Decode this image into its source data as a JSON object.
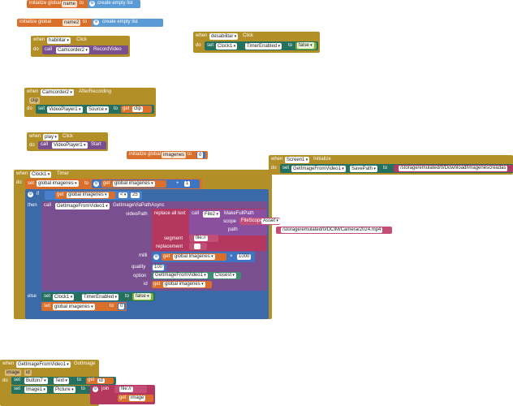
{
  "labels": {
    "init_global": "initialize global",
    "init_global_lc": "initialize global",
    "to": "to",
    "create_empty_list": "create empty list",
    "when": "when",
    "do": "do",
    "call": "call",
    "set": "set",
    "get": "get",
    "if": "if",
    "then": "then",
    "else": "else",
    "join": "join",
    "replace_all_text": "replace all text",
    "segment": "segment",
    "replacement": "replacement",
    "scope": "scope",
    "path": "path",
    "videoPath": "videoPath",
    "milli": "milli",
    "quality": "quality",
    "option": "option",
    "id": "id",
    "times": "×",
    "plus": "+",
    "lt": "<"
  },
  "blocks": {
    "init_name": {
      "var": "name",
      "value": "create empty list"
    },
    "init_name2": {
      "var": "name2",
      "value": "create empty list"
    },
    "habilitar": {
      "component": "habilitar",
      "event": "Click",
      "call_component": "Camcorder2",
      "method": "RecordVideo"
    },
    "desabilitar": {
      "component": "desabilitar",
      "event": "Click",
      "set_component": "Clock1",
      "property": "TimerEnabled",
      "value": "false"
    },
    "after_recording": {
      "component": "Camcorder2",
      "event": "AfterRecording",
      "param": "clip",
      "set_component": "VideoPlayer1",
      "property": "Source",
      "get_var": "clip"
    },
    "play": {
      "component": "play",
      "event": "Click",
      "call_component": "VideoPlayer1",
      "method": "Start"
    },
    "init_imagenes": {
      "var": "imagenes",
      "value": "0"
    },
    "screen_init": {
      "component": "Screen1",
      "event": "Initialize",
      "set_component": "GetImageFromVideo1",
      "property": "SavePath",
      "value": "/storage/emulated/0/Download/imagenescreadas"
    },
    "timer": {
      "component": "Clock1",
      "event": "Timer",
      "set_var": "global imagenes",
      "get_var": "global imagenes",
      "add_value": "1",
      "cond_var": "global imagenes",
      "cond_value": "25",
      "call_component": "GetImageFromVideo1",
      "method": "GetImageViaPathAsync",
      "file_component": "File2",
      "file_method": "MakeFullPath",
      "scope_value": "FileScope",
      "scope_option": "Asset",
      "path_value": "/storage/emulated/0/DCIM/Camera/2024.mp4",
      "segment_value": "file://",
      "replacement_value": "",
      "milli_var": "global imagenes",
      "milli_value": "1000",
      "quality_value": "100",
      "option_component": "GetImageFromVideo1",
      "option_value": "Closest",
      "id_var": "global imagenes",
      "else_component": "Clock1",
      "else_property": "TimerEnabled",
      "else_value": "false",
      "else_set_var": "global imagenes",
      "else_set_value": "0"
    },
    "got_image": {
      "component": "GetImageFromVideo1",
      "event": "GotImage",
      "params": [
        "image",
        "id"
      ],
      "set1_component": "Button7",
      "set1_property": "Text",
      "set1_var": "id",
      "set2_component": "Image1",
      "set2_property": "Picture",
      "join_text": "file://",
      "join_var": "image"
    }
  }
}
